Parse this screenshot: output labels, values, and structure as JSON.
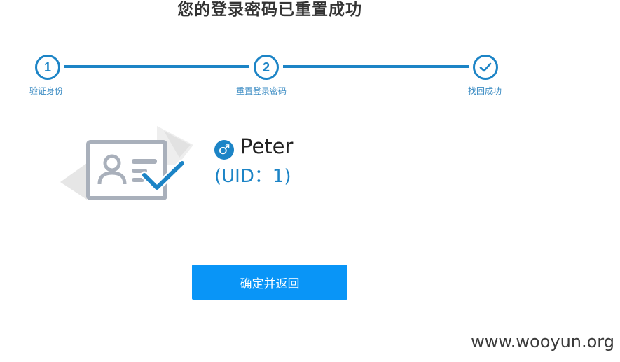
{
  "page": {
    "title": "您的登录密码已重置成功"
  },
  "steps": [
    {
      "number": "1",
      "label": "验证身份"
    },
    {
      "number": "2",
      "label": "重置登录密码"
    },
    {
      "number": "check",
      "label": "找回成功",
      "icon": "checkmark-icon"
    }
  ],
  "colors": {
    "accent": "#1c84c6",
    "button": "#0995f7",
    "step_label": "#3d8dc4"
  },
  "user": {
    "gender_symbol": "♂",
    "gender_icon": "male-icon",
    "name": "Peter",
    "uid_text": "(UID：1)"
  },
  "actions": {
    "confirm_label": "确定并返回"
  },
  "watermark": {
    "text": "www.wooyun.org"
  }
}
